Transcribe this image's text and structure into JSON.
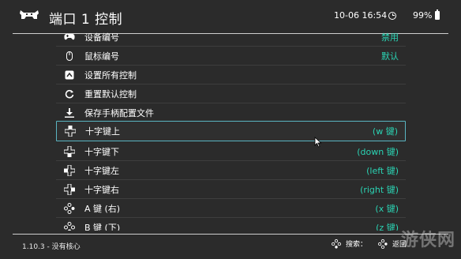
{
  "header": {
    "title": "端口 1 控制",
    "clock": "10-06 16:54",
    "battery": "99%"
  },
  "rows": [
    {
      "icon": "gamepad-icon",
      "label": "设备编号",
      "value": "禁用"
    },
    {
      "icon": "mouse-icon",
      "label": "鼠标编号",
      "value": "默认"
    },
    {
      "icon": "settings-all-icon",
      "label": "设置所有控制",
      "value": ""
    },
    {
      "icon": "reset-icon",
      "label": "重置默认控制",
      "value": ""
    },
    {
      "icon": "download-icon",
      "label": "保存手柄配置文件",
      "value": ""
    },
    {
      "icon": "dpad-up-icon",
      "label": "十字键上",
      "value": "(w 键)"
    },
    {
      "icon": "dpad-down-icon",
      "label": "十字键下",
      "value": "(down 键)"
    },
    {
      "icon": "dpad-left-icon",
      "label": "十字键左",
      "value": "(left 键)"
    },
    {
      "icon": "dpad-right-icon",
      "label": "十字键右",
      "value": "(right 键)"
    },
    {
      "icon": "button-a-icon",
      "label": "A 键 (右)",
      "value": "(x 键)"
    },
    {
      "icon": "button-b-icon",
      "label": "B 键 (下)",
      "value": "(z 键)"
    }
  ],
  "footer": {
    "version": "1.10.3 - 没有核心",
    "search": "搜索：",
    "back": "返回"
  },
  "watermark": "游侠网",
  "colors": {
    "accent": "#2bd4b4",
    "selection_border": "#5ab5c2",
    "background": "#2b2b2b"
  }
}
